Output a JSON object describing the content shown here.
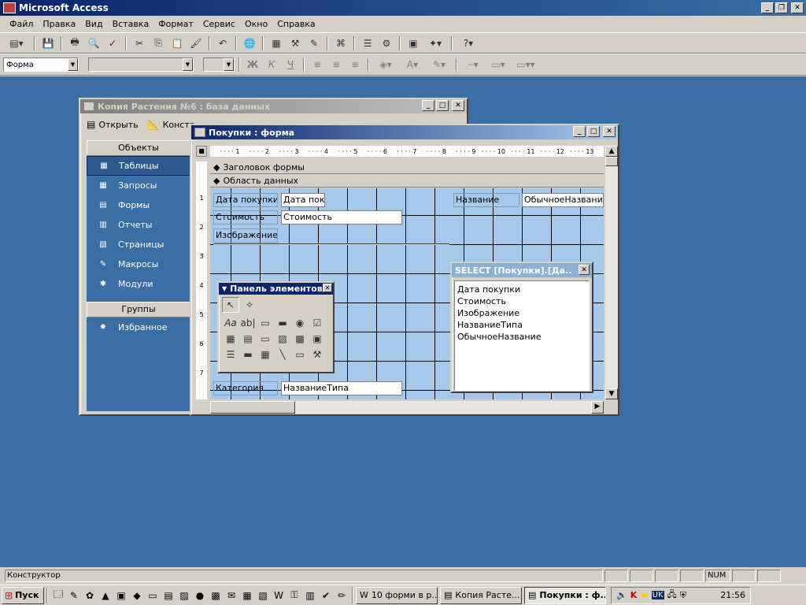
{
  "app": {
    "title": "Microsoft Access"
  },
  "menu": [
    "Файл",
    "Правка",
    "Вид",
    "Вставка",
    "Формат",
    "Сервис",
    "Окно",
    "Справка"
  ],
  "format_bar": {
    "object_combo": "Форма",
    "bold": "Ж",
    "italic": "К",
    "underline": "Ч"
  },
  "db_window": {
    "title": "Копия Растения №6 : база данных",
    "open_label": "Открыть",
    "design_label": "Констр",
    "objects_header": "Объекты",
    "items": [
      {
        "label": "Таблицы",
        "icon": "table-icon"
      },
      {
        "label": "Запросы",
        "icon": "query-icon"
      },
      {
        "label": "Формы",
        "icon": "form-icon"
      },
      {
        "label": "Отчеты",
        "icon": "report-icon"
      },
      {
        "label": "Страницы",
        "icon": "page-icon"
      },
      {
        "label": "Макросы",
        "icon": "macro-icon"
      },
      {
        "label": "Модули",
        "icon": "module-icon"
      }
    ],
    "groups_header": "Группы",
    "favorites_label": "Избранное"
  },
  "form_window": {
    "title": "Покупки : форма",
    "ruler_marks": [
      "1",
      "2",
      "3",
      "4",
      "5",
      "6",
      "7",
      "8",
      "9",
      "10",
      "11",
      "12",
      "13"
    ],
    "vruler_marks": [
      "1",
      "2",
      "3",
      "4",
      "5",
      "6",
      "7"
    ],
    "header_section": "Заголовок формы",
    "detail_section": "Область данных",
    "controls": {
      "date_label": "Дата покупки",
      "date_field": "Дата покуп",
      "cost_label": "Стоимость",
      "cost_field": "Стоимость",
      "image_label": "Изображение",
      "name_label": "Название",
      "name_field": "ОбычноеНазвание",
      "category_label": "Категория",
      "category_field": "НазваниеТипа"
    }
  },
  "toolbox": {
    "title": "Панель элементов"
  },
  "field_list": {
    "title": "SELECT [Покупки].[Да...",
    "fields": [
      "Дата покупки",
      "Стоимость",
      "Изображение",
      "НазваниеТипа",
      "ОбычноеНазвание"
    ]
  },
  "status": {
    "text": "Конструктор",
    "num": "NUM"
  },
  "taskbar": {
    "start_label": "Пуск",
    "tasks": [
      "10 форми в р...",
      "Копия Расте...",
      "Покупки : ф..."
    ],
    "tray_lang": "UK",
    "clock": "21:56"
  }
}
